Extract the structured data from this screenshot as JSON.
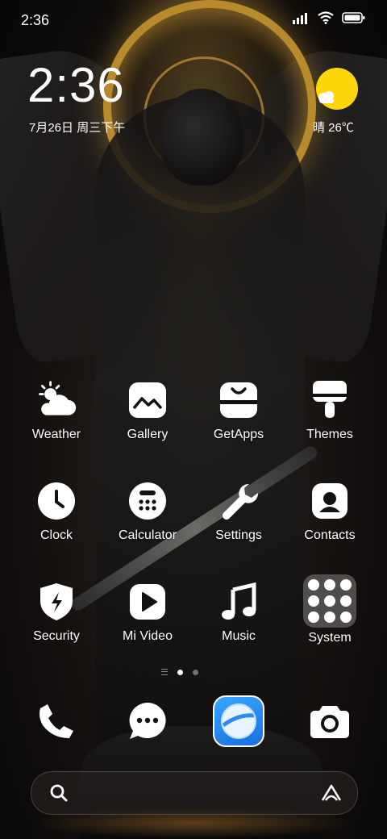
{
  "status_bar": {
    "time": "2:36",
    "icons": [
      "signal-icon",
      "wifi-icon",
      "battery-icon"
    ]
  },
  "widget": {
    "time": "2:36",
    "date": "7月26日 周三下午",
    "weather": "晴 26℃",
    "weather_icon": "sun-cloud-icon",
    "sun_color": "#ffd60a"
  },
  "apps": [
    {
      "label": "Weather",
      "icon": "weather-icon"
    },
    {
      "label": "Gallery",
      "icon": "gallery-icon"
    },
    {
      "label": "GetApps",
      "icon": "getapps-icon"
    },
    {
      "label": "Themes",
      "icon": "themes-icon"
    },
    {
      "label": "Clock",
      "icon": "clock-icon"
    },
    {
      "label": "Calculator",
      "icon": "calculator-icon"
    },
    {
      "label": "Settings",
      "icon": "wrench-icon"
    },
    {
      "label": "Contacts",
      "icon": "contacts-icon"
    },
    {
      "label": "Security",
      "icon": "security-shield-icon"
    },
    {
      "label": "Mi Video",
      "icon": "play-icon"
    },
    {
      "label": "Music",
      "icon": "music-note-icon"
    },
    {
      "label": "System",
      "icon": "folder-icon"
    }
  ],
  "page_indicator": {
    "pages": 2,
    "current": 1
  },
  "dock": [
    {
      "icon": "phone-icon"
    },
    {
      "icon": "messages-icon"
    },
    {
      "icon": "browser-icon",
      "color": "#2a8cf0"
    },
    {
      "icon": "camera-icon"
    }
  ],
  "search_bar": {
    "left_icon": "search-icon",
    "right_icon": "assistant-icon"
  }
}
